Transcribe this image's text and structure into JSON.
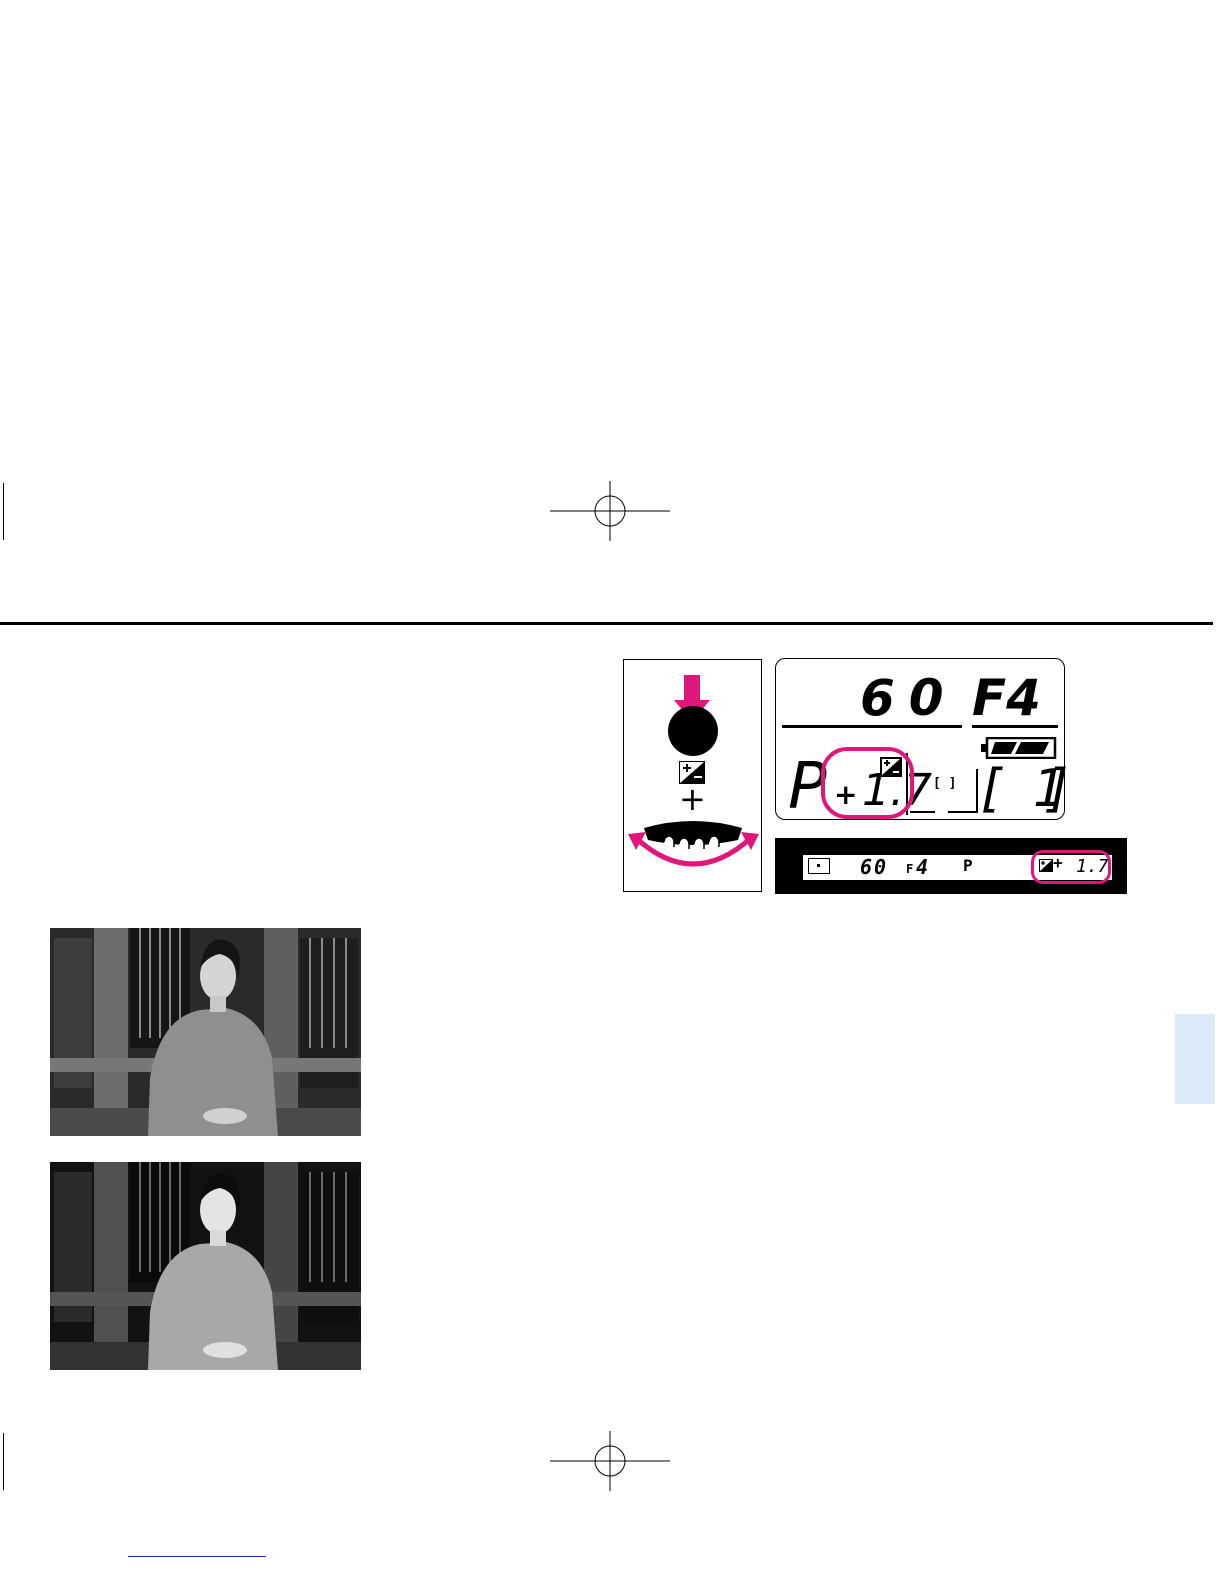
{
  "colors": {
    "accent": "#e0177a",
    "ink": "#000000",
    "tab": "#dbeaf6",
    "underline": "#1a3aa8"
  },
  "control_panel": {
    "button_icon": "exposure-compensation-button-icon",
    "plus_sign": "+",
    "dial_icon": "command-dial-icon"
  },
  "lcd": {
    "shutter": "60",
    "aperture": "F4",
    "mode": "P",
    "comp_sign": "+",
    "comp_value": "1.7",
    "frame_count": "1",
    "battery_icon": "battery-icon"
  },
  "viewfinder": {
    "shutter": "60",
    "aperture_prefix": "F",
    "aperture": "4",
    "mode": "P",
    "comp_sign": "+",
    "comp_value": "1.7"
  },
  "photos": [
    {
      "id": "photo-without-compensation"
    },
    {
      "id": "photo-with-compensation"
    }
  ]
}
